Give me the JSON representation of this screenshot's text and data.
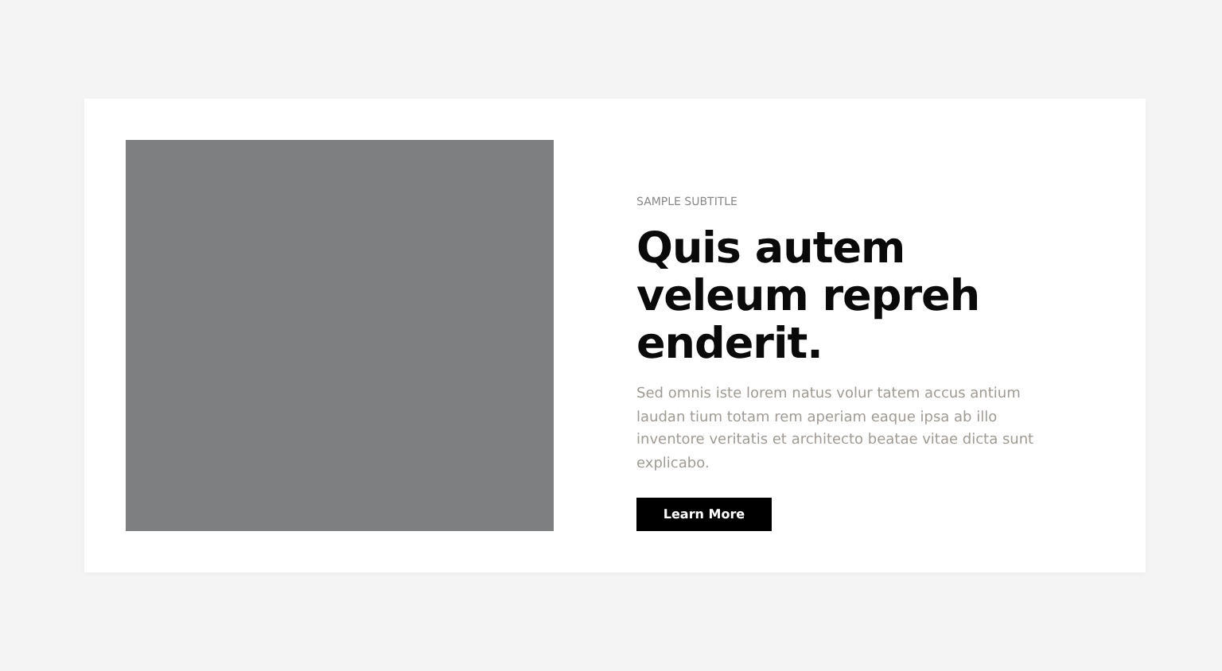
{
  "image": {
    "kind": "placeholder"
  },
  "subtitle": "SAMPLE SUBTITLE",
  "title": "Quis autem veleum repreh enderit.",
  "body": "Sed omnis iste lorem natus volur tatem accus antium laudan tium totam rem aperiam eaque ipsa ab illo inventore veritatis et architecto beatae vitae dicta sunt explicabo.",
  "button": "Learn More"
}
